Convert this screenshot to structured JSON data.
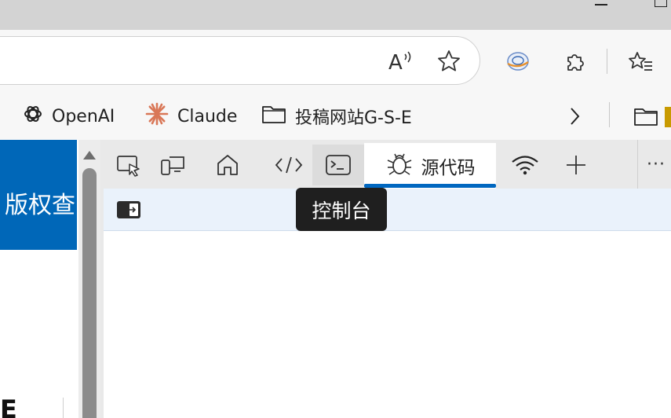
{
  "address_bar": {
    "read_aloud_icon": "read-aloud-icon",
    "favorite_icon": "star-icon"
  },
  "toolbar": {
    "extension_icons": [
      "translate-globe-icon",
      "puzzle-icon",
      "favorites-list-icon"
    ]
  },
  "favorites": {
    "items": [
      {
        "label": "OpenAI",
        "icon": "openai-logo-icon"
      },
      {
        "label": "Claude",
        "icon": "claude-logo-icon"
      },
      {
        "label": "投稿网站G-S-E",
        "icon": "folder-icon"
      }
    ],
    "overflow_icon": "chevron-right-icon"
  },
  "page": {
    "banner_text": "版权查",
    "partial_letter": "E",
    "banner_color": "#0067b8"
  },
  "devtools": {
    "tabs": [
      {
        "name": "inspect",
        "icon": "inspect-icon"
      },
      {
        "name": "device",
        "icon": "device-emulation-icon"
      },
      {
        "name": "welcome",
        "icon": "home-icon"
      },
      {
        "name": "elements",
        "icon": "code-icon"
      },
      {
        "name": "console",
        "icon": "console-icon"
      },
      {
        "name": "network",
        "icon": "wifi-icon"
      },
      {
        "name": "more-tools",
        "icon": "plus-icon"
      }
    ],
    "active_tab": {
      "label": "源代码",
      "icon": "bug-icon"
    },
    "more_label": "···",
    "tooltip": "控制台",
    "accent": "#0067c0"
  }
}
